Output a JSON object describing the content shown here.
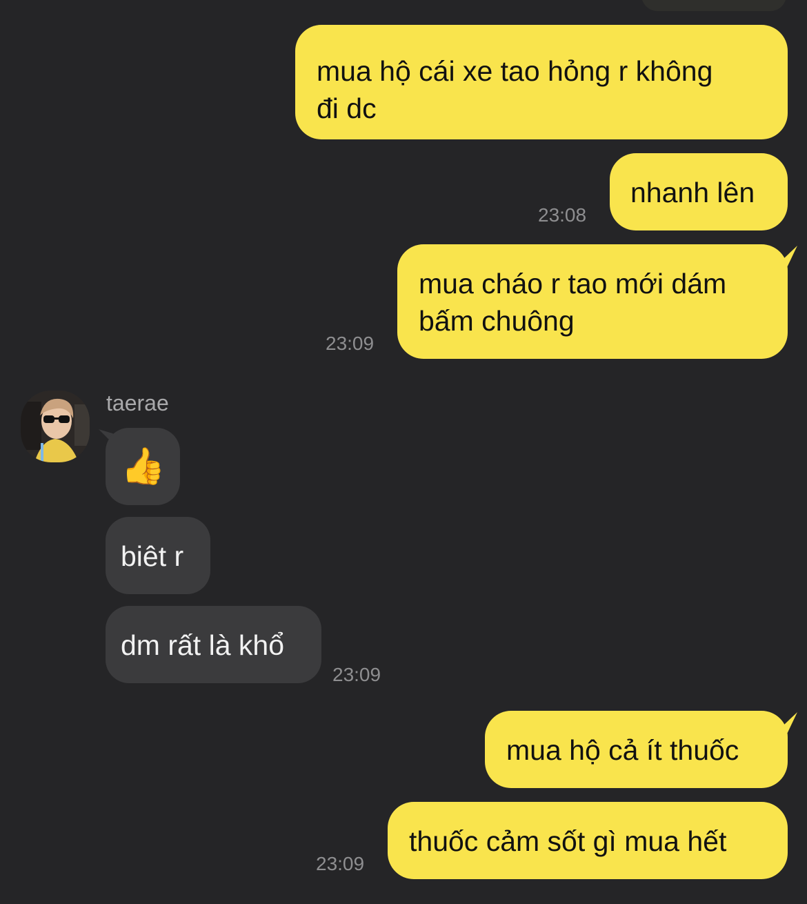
{
  "messages": [
    {
      "text": "mua hộ cái xe tao hỏng r không\nđi dc",
      "time": ""
    },
    {
      "text": "nhanh lên",
      "time": "23:08"
    },
    {
      "text": "mua cháo r tao mới dám\nbấm chuông",
      "time": "23:09"
    },
    {
      "sender": "taerae",
      "emoji": "👍"
    },
    {
      "text": "biêt r"
    },
    {
      "text": "dm rất là khổ",
      "time": "23:09"
    },
    {
      "text": "mua hộ cả ít thuốc"
    },
    {
      "text": "thuốc cảm sốt gì mua hết",
      "time": "23:09"
    }
  ],
  "colors": {
    "background": "#252527",
    "mine_bubble": "#f9e44d",
    "their_bubble": "#3b3b3d",
    "timestamp": "#8e8e90"
  }
}
